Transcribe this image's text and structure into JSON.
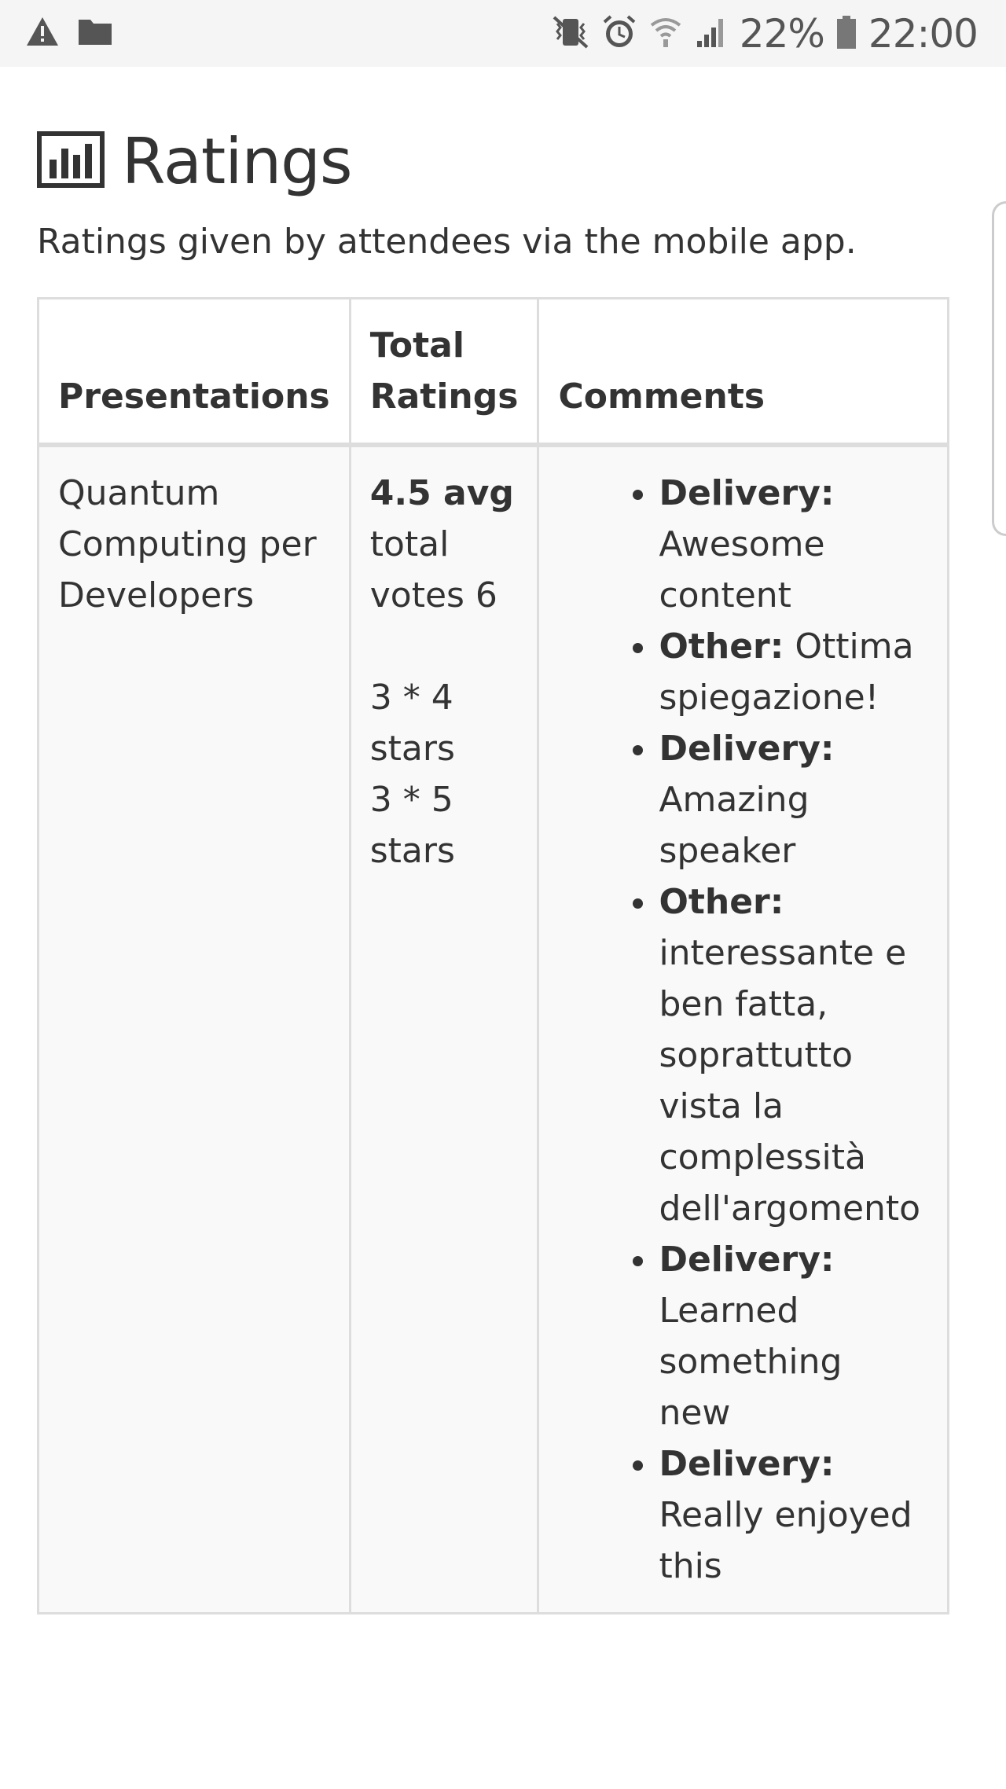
{
  "status_bar": {
    "battery": "22%",
    "time": "22:00",
    "icons": [
      "warning-icon",
      "folder-icon",
      "vibrate-icon",
      "alarm-icon",
      "wifi-icon",
      "signal-icon",
      "battery-icon"
    ]
  },
  "page": {
    "icon": "bar-chart-icon",
    "title": "Ratings",
    "subtitle": "Ratings given by attendees via the mobile app."
  },
  "table": {
    "headers": {
      "presentations": "Presentations",
      "total_ratings_1": "Total",
      "total_ratings_2": "Ratings",
      "comments": "Comments"
    },
    "rows": [
      {
        "presentation": "Quantum Computing per Developers",
        "avg": "4.5 avg",
        "total_votes": "total votes 6",
        "breakdown": [
          "3 * 4 stars",
          "3 * 5 stars"
        ],
        "comments": [
          {
            "category": "Delivery:",
            "text": "Awesome content"
          },
          {
            "category": "Other:",
            "text": "Ottima spiegazione!"
          },
          {
            "category": "Delivery:",
            "text": "Amazing speaker"
          },
          {
            "category": "Other:",
            "text": "interessante e ben fatta, soprattutto vista la complessità dell'argomento"
          },
          {
            "category": "Delivery:",
            "text": "Learned something new"
          },
          {
            "category": "Delivery:",
            "text": "Really enjoyed this"
          }
        ]
      }
    ]
  },
  "colors": {
    "status_bar_bg": "#f5f5f5",
    "text": "#333333",
    "table_border": "#dddddd",
    "row_bg": "#f9f9f9"
  }
}
